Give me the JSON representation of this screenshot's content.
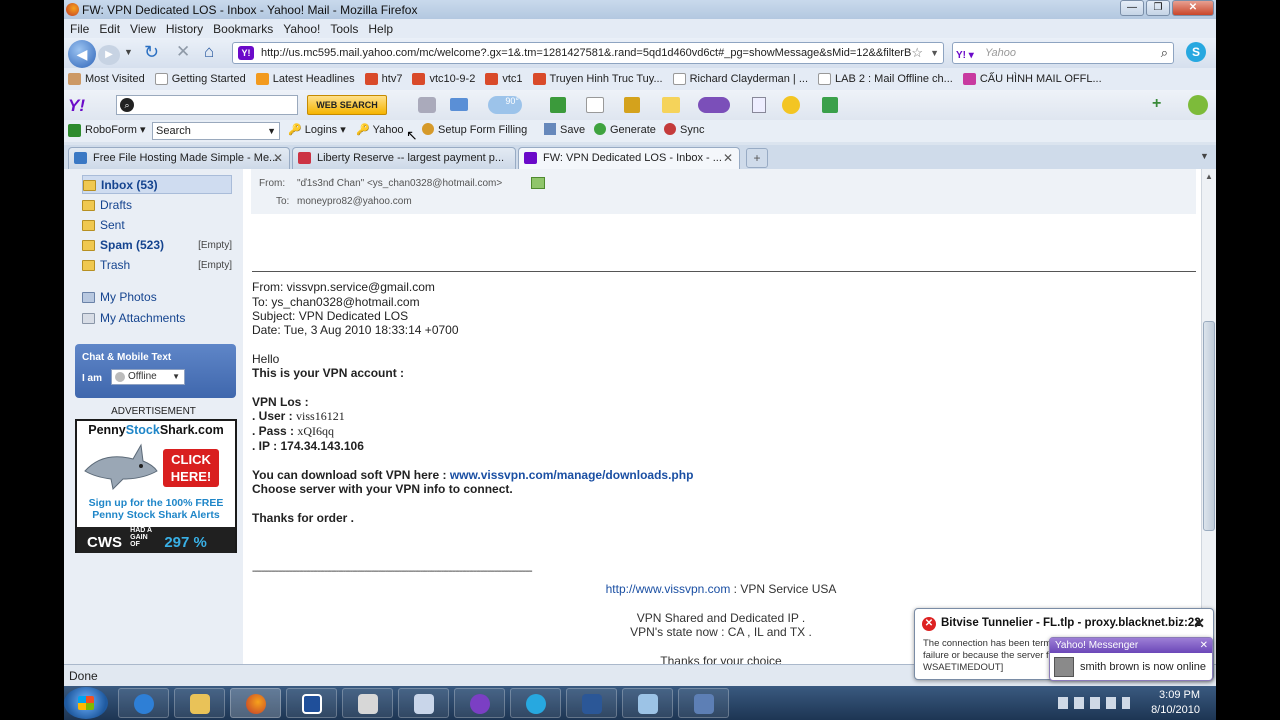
{
  "window": {
    "title": "FW: VPN Dedicated LOS - Inbox - Yahoo! Mail - Mozilla Firefox"
  },
  "menu": [
    "File",
    "Edit",
    "View",
    "History",
    "Bookmarks",
    "Yahoo!",
    "Tools",
    "Help"
  ],
  "nav": {
    "url": "http://us.mc595.mail.yahoo.com/mc/welcome?.gx=1&.tm=1281427581&.rand=5qd1d460vd6ct#_pg=showMessage&sMid=12&&filterB",
    "search_placeholder": "Yahoo"
  },
  "bookmarks": [
    "Most Visited",
    "Getting Started",
    "Latest Headlines",
    "htv7",
    "vtc10-9-2",
    "vtc1",
    "Truyen Hinh Truc Tuy...",
    "Richard Clayderman | ...",
    "LAB 2 : Mail Offline ch...",
    "CẤU HÌNH MAIL OFFL..."
  ],
  "yahoo_toolbar": {
    "logo": "Y!",
    "web_search": "WEB SEARCH",
    "temp": "90°"
  },
  "roboform": {
    "label": "RoboForm",
    "search": "Search",
    "logins": "Logins",
    "yahoo": "Yahoo",
    "setup": "Setup Form Filling",
    "save": "Save",
    "generate": "Generate",
    "sync": "Sync"
  },
  "tabs": [
    {
      "label": "Free File Hosting Made Simple - Me..."
    },
    {
      "label": "Liberty Reserve -- largest payment p..."
    },
    {
      "label": "FW: VPN Dedicated LOS - Inbox - ..."
    }
  ],
  "sidebar": {
    "folders": [
      {
        "label": "Inbox (53)",
        "empty": ""
      },
      {
        "label": "Drafts",
        "empty": ""
      },
      {
        "label": "Sent",
        "empty": ""
      },
      {
        "label": "Spam (523)",
        "empty": "[Empty]"
      },
      {
        "label": "Trash",
        "empty": "[Empty]"
      },
      {
        "label": "My Photos",
        "empty": ""
      },
      {
        "label": "My Attachments",
        "empty": ""
      }
    ],
    "chat_title": "Chat & Mobile Text",
    "i_am": "I am",
    "status": "Offline",
    "ad_label": "ADVERTISEMENT",
    "ad": {
      "title_a": "Penny",
      "title_b": "Stock",
      "title_c": "Shark.com",
      "click": "CLICK HERE!",
      "signup_1": "Sign up for the 100% FREE",
      "signup_2": "Penny Stock Shark Alerts",
      "cws": "CWS",
      "gain": "HAD A GAIN OF",
      "pct": "297 %"
    }
  },
  "message": {
    "header_from_label": "From:",
    "header_from": "\"ď1s3nđ Chan\" <ys_chan0328@hotmail.com>",
    "header_to_label": "To:",
    "header_to": "moneypro82@yahoo.com",
    "fw_from": "From: vissvpn.service@gmail.com",
    "fw_to": "To: ys_chan0328@hotmail.com",
    "fw_subject": "Subject: VPN Dedicated LOS",
    "fw_date": "Date: Tue, 3 Aug 2010 18:33:14 +0700",
    "hello": "Hello",
    "account": "This is your VPN account :",
    "vpn_los": "VPN Los :",
    "user_label": ". User :",
    "user": "viss16121",
    "pass_label": ". Pass :",
    "pass": "xQI6qq",
    "ip_label": ". IP :",
    "ip": "174.34.143.106",
    "download_text": "You can download soft VPN here :",
    "download_link": "www.vissvpn.com/manage/downloads.php",
    "choose": "Choose server with your VPN info to connect.",
    "thanks": "Thanks for order .",
    "divider": "------------------------------------------------------------------------------------------------------------------------",
    "site_link": "http://www.vissvpn.com",
    "site_text": " : VPN Service USA",
    "shared": "VPN Shared and Dedicated IP .",
    "state": "VPN's state now : CA , IL and TX .",
    "choice": "Thanks for your choice"
  },
  "status": "Done",
  "popup_bitvise": {
    "title": "Bitvise Tunnelier - FL.tlp - proxy.blacknet.biz:22",
    "body_1": "The connection has been term",
    "body_2": "failure or because the server f",
    "body_3": "WSAETIMEDOUT]"
  },
  "popup_ym": {
    "title": "Yahoo! Messenger",
    "text": "smith  brown is now online"
  },
  "clock": {
    "time": "3:09 PM",
    "date": "8/10/2010"
  },
  "colors": {
    "accent": "#1a4fa3",
    "yahoo_purple": "#6b0ac9"
  }
}
